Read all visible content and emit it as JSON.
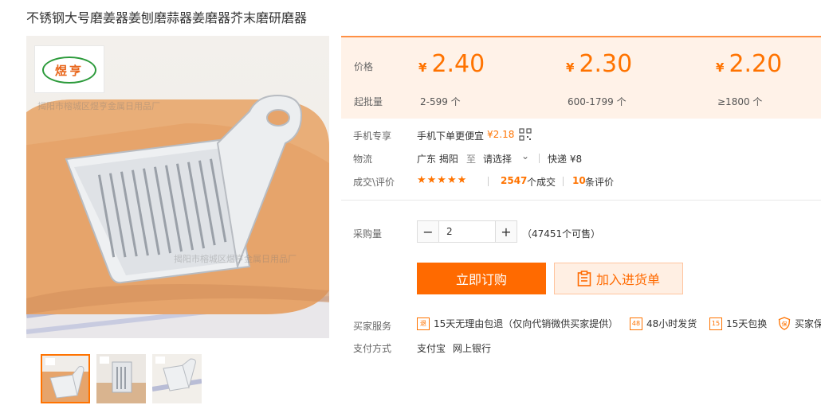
{
  "product": {
    "title": "不锈钢大号磨姜器姜刨磨蒜器姜磨器芥末磨研磨器",
    "logo_text": "煜亨",
    "watermark": "揭阳市榕城区煜亨金属日用品厂"
  },
  "pricing": {
    "price_label": "价格",
    "batch_label": "起批量",
    "tiers": [
      {
        "currency": "¥",
        "price": "2.40",
        "range": "2-599 个"
      },
      {
        "currency": "¥",
        "price": "2.30",
        "range": "600-1799 个"
      },
      {
        "currency": "¥",
        "price": "2.20",
        "range": "≥1800 个"
      }
    ]
  },
  "mobile": {
    "label": "手机专享",
    "text": "手机下单更便宜",
    "price": "¥2.18",
    "icon": "qr-code-icon"
  },
  "logistics": {
    "label": "物流",
    "from": "广东 揭阳",
    "to_word": "至",
    "select": "请选择",
    "shipping": "快递 ¥8"
  },
  "trade": {
    "label": "成交\\评价",
    "stars": "★★★★★",
    "deals_count": "2547",
    "deals_text": "个成交",
    "reviews_count": "10",
    "reviews_text": "条评价"
  },
  "purchase": {
    "label": "采购量",
    "quantity": "2",
    "minus": "−",
    "plus": "+",
    "available": "（47451个可售）"
  },
  "actions": {
    "buy_now": "立即订购",
    "add_cart": "加入进货单"
  },
  "services": {
    "label": "买家服务",
    "items": [
      {
        "icon": "return-15-icon",
        "badge": "退",
        "text": "15天无理由包退（仅向代销微供买家提供）"
      },
      {
        "icon": "ship-48-icon",
        "badge": "48",
        "text": "48小时发货"
      },
      {
        "icon": "exchange-15-icon",
        "badge": "15",
        "text": "15天包换"
      },
      {
        "icon": "shield-icon",
        "badge": "保",
        "text": "买家保障"
      }
    ]
  },
  "payment": {
    "label": "支付方式",
    "methods": [
      "支付宝",
      "网上银行"
    ]
  },
  "colors": {
    "accent": "#ff7300",
    "price_bg": "#fff2e8",
    "buy_button": "#ff6a00",
    "logo_green": "#2b9a3a"
  }
}
